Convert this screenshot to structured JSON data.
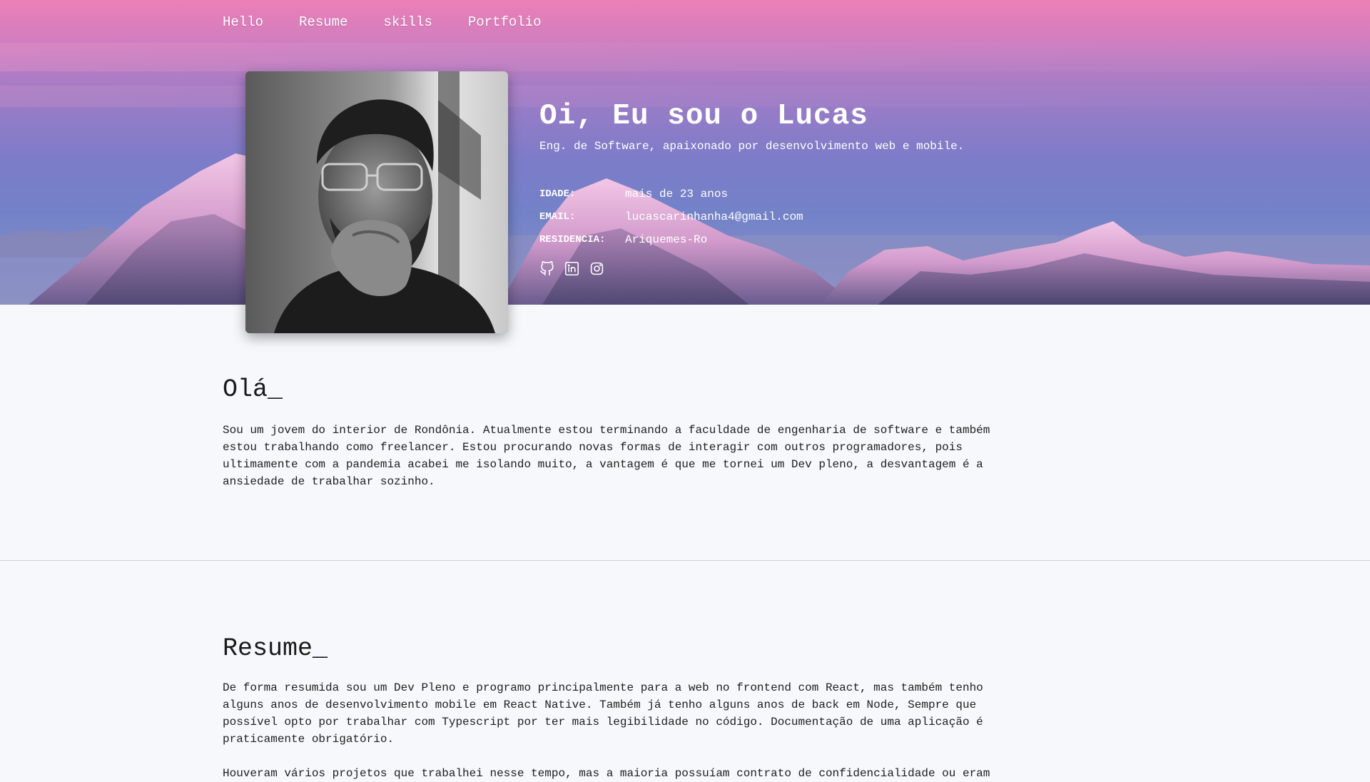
{
  "nav": {
    "items": [
      "Hello",
      "Resume",
      "skills",
      "Portfolio"
    ]
  },
  "hero": {
    "title": "Oi, Eu sou o Lucas",
    "subtitle": "Eng. de Software, apaixonado por desenvolvimento web e mobile.",
    "info": [
      {
        "key": "IDADE:",
        "value": "mais de 23 anos"
      },
      {
        "key": "EMAIL:",
        "value": "lucascarinhanha4@gmail.com"
      },
      {
        "key": "RESIDENCIA:",
        "value": "Ariquemes-Ro"
      }
    ],
    "socials": [
      "github-icon",
      "linkedin-icon",
      "instagram-icon"
    ]
  },
  "hello": {
    "title": "Olá_",
    "text": "Sou um jovem do interior de Rondônia. Atualmente estou terminando a faculdade de engenharia de software e também estou trabalhando como freelancer. Estou procurando novas formas de interagir com outros programadores, pois ultimamente com a pandemia acabei me isolando muito, a vantagem é que me tornei um Dev pleno, a desvantagem é a ansiedade de trabalhar sozinho."
  },
  "resume": {
    "title": "Resume_",
    "text": "De forma resumida sou um Dev Pleno e programo principalmente para a web no frontend com React, mas também tenho alguns anos de desenvolvimento mobile em React Native. Também já tenho alguns anos de back em Node, Sempre que possível opto por trabalhar com Typescript por ter mais legibilidade no código. Documentação de uma aplicação é praticamente obrigatório.",
    "text2": "Houveram vários projetos que trabalhei nesse tempo, mas a maioria possuíam contrato de confidencialidade ou eram"
  },
  "colors": {
    "hero_top": "#ec7fb6",
    "hero_bottom": "#7382c8",
    "page_background": "#f7f8fb"
  }
}
